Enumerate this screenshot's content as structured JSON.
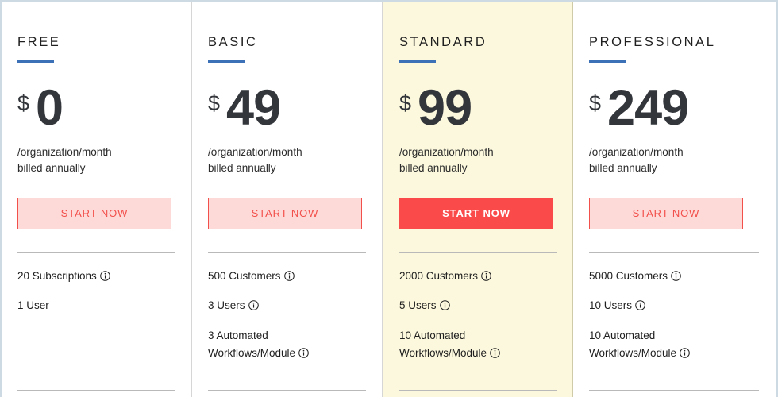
{
  "accent_color": "#3c71b8",
  "cta_outline_color": "#f2504b",
  "cta_outline_bg": "#fdd9d8",
  "cta_filled_bg": "#fb4a4a",
  "featured_bg": "#fcf8dd",
  "plans": [
    {
      "name": "FREE",
      "currency": "$",
      "amount": "0",
      "billing_line1": "/organization/month",
      "billing_line2": "billed annually",
      "cta_label": "START NOW",
      "featured": false,
      "features": [
        {
          "text": "20 Subscriptions",
          "info": true
        },
        {
          "text": "1 User",
          "info": false
        }
      ]
    },
    {
      "name": "BASIC",
      "currency": "$",
      "amount": "49",
      "billing_line1": "/organization/month",
      "billing_line2": "billed annually",
      "cta_label": "START NOW",
      "featured": false,
      "features": [
        {
          "text": "500 Customers",
          "info": true
        },
        {
          "text": "3 Users",
          "info": true
        },
        {
          "text": "3 Automated Workflows/Module",
          "info": true
        }
      ]
    },
    {
      "name": "STANDARD",
      "currency": "$",
      "amount": "99",
      "billing_line1": "/organization/month",
      "billing_line2": "billed annually",
      "cta_label": "START NOW",
      "featured": true,
      "features": [
        {
          "text": "2000 Customers",
          "info": true
        },
        {
          "text": "5 Users",
          "info": true
        },
        {
          "text": "10 Automated Workflows/Module",
          "info": true
        }
      ]
    },
    {
      "name": "PROFESSIONAL",
      "currency": "$",
      "amount": "249",
      "billing_line1": "/organization/month",
      "billing_line2": "billed annually",
      "cta_label": "START NOW",
      "featured": false,
      "features": [
        {
          "text": "5000 Customers",
          "info": true
        },
        {
          "text": "10 Users",
          "info": true
        },
        {
          "text": "10 Automated Workflows/Module",
          "info": true
        }
      ]
    }
  ]
}
